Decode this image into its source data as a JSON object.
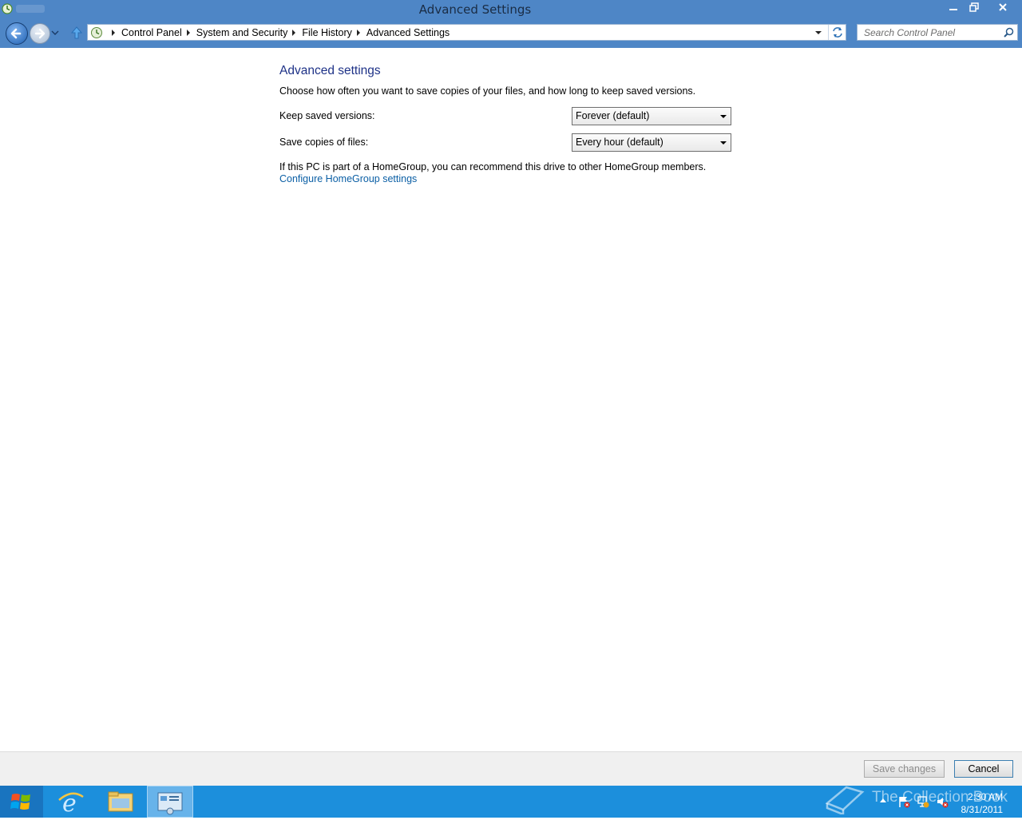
{
  "window": {
    "title": "Advanced Settings",
    "controls": {
      "minimize": "minimize-icon",
      "maximize": "restore-icon",
      "close": "close-icon"
    }
  },
  "nav": {
    "breadcrumbs": [
      "Control Panel",
      "System and Security",
      "File History",
      "Advanced Settings"
    ],
    "search_placeholder": "Search Control Panel"
  },
  "main": {
    "heading": "Advanced settings",
    "description": "Choose how often you want to save copies of your files, and how long to keep saved versions.",
    "keep_versions_label": "Keep saved versions:",
    "keep_versions_value": "Forever (default)",
    "save_copies_label": "Save copies of files:",
    "save_copies_value": "Every hour (default)",
    "homegroup_text": "If this PC is part of a HomeGroup, you can recommend this drive to other HomeGroup members.",
    "homegroup_link": "Configure HomeGroup settings"
  },
  "buttons": {
    "save": "Save changes",
    "cancel": "Cancel"
  },
  "taskbar": {
    "apps": [
      "internet-explorer-icon",
      "file-explorer-icon",
      "control-panel-icon"
    ],
    "time": "2:30 AM",
    "date": "8/31/2011",
    "watermark": "The Collection Book"
  },
  "colors": {
    "titlebar": "#4e86c6",
    "taskbar": "#1c8fdc",
    "heading": "#1e3287",
    "link": "#0b5fa5"
  }
}
